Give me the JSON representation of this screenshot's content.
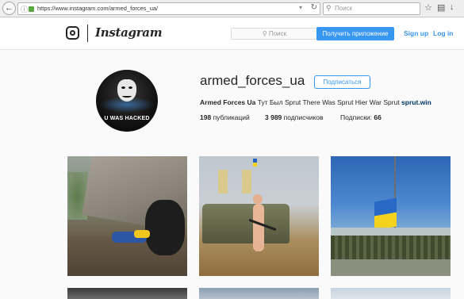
{
  "browser": {
    "url": "https://www.instagram.com/armed_forces_ua/",
    "search_placeholder": "Поиск"
  },
  "header": {
    "logo_text": "Instagram",
    "search_placeholder": "Поиск",
    "get_app_label": "Получить приложение",
    "signup_label": "Sign up",
    "login_label": "Log in"
  },
  "profile": {
    "username": "armed_forces_ua",
    "follow_label": "Подписаться",
    "avatar_text": "U WAS HACKED",
    "bio_name": "Armed Forces Ua",
    "bio_text": " Тут Был Sprut There Was Sprut Hier War Sprut ",
    "bio_link": "sprut.win",
    "posts_count": "198",
    "posts_label": "публикаций",
    "followers_count": "3 989",
    "followers_label": "подписчиков",
    "following_label": "Подписки:",
    "following_count": "66"
  },
  "colors": {
    "accent": "#3897f0",
    "text": "#262626",
    "background": "#fafafa"
  }
}
